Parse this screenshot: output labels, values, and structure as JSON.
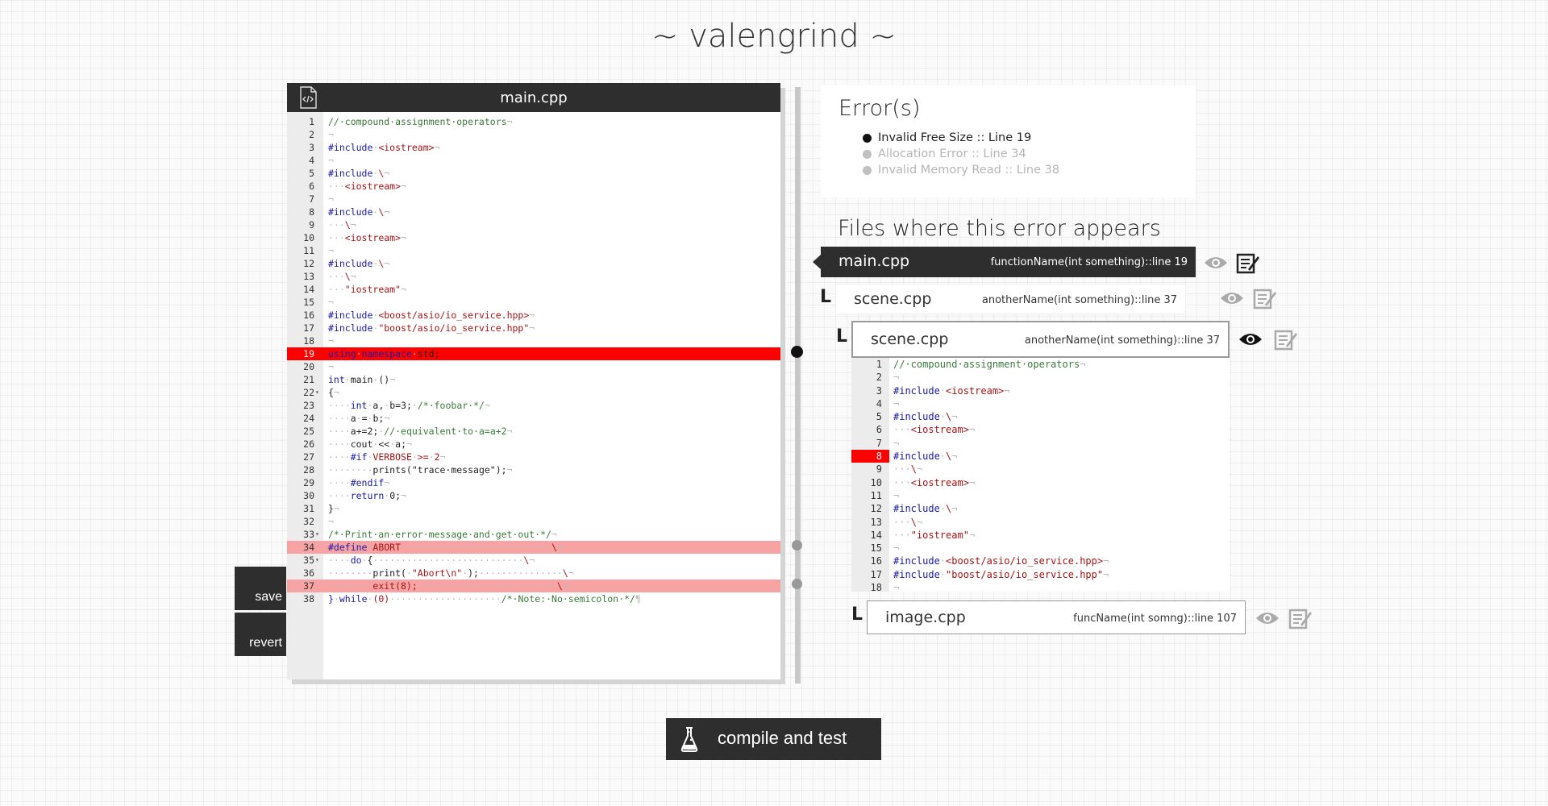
{
  "app": {
    "title": "~ valengrind ~"
  },
  "editor": {
    "filename": "main.cpp",
    "lines": [
      {
        "n": "1",
        "fold": "",
        "state": "",
        "tokens": [
          [
            "cm",
            "//·compound·assignment·operators"
          ],
          [
            "ws",
            "¬"
          ]
        ]
      },
      {
        "n": "2",
        "fold": "",
        "state": "",
        "tokens": [
          [
            "ws",
            "¬"
          ]
        ]
      },
      {
        "n": "3",
        "fold": "",
        "state": "",
        "tokens": [
          [
            "kw",
            "#include"
          ],
          [
            "ws",
            "·"
          ],
          [
            "st",
            "<iostream>"
          ],
          [
            "ws",
            "¬"
          ]
        ]
      },
      {
        "n": "4",
        "fold": "",
        "state": "",
        "tokens": [
          [
            "ws",
            "¬"
          ]
        ]
      },
      {
        "n": "5",
        "fold": "",
        "state": "",
        "tokens": [
          [
            "kw",
            "#include"
          ],
          [
            "ws",
            "·"
          ],
          [
            "st",
            "\\"
          ],
          [
            "ws",
            "¬"
          ]
        ]
      },
      {
        "n": "6",
        "fold": "",
        "state": "",
        "tokens": [
          [
            "ws",
            "···"
          ],
          [
            "st",
            "<iostream>"
          ],
          [
            "ws",
            "¬"
          ]
        ]
      },
      {
        "n": "7",
        "fold": "",
        "state": "",
        "tokens": [
          [
            "ws",
            "¬"
          ]
        ]
      },
      {
        "n": "8",
        "fold": "",
        "state": "",
        "tokens": [
          [
            "kw",
            "#include"
          ],
          [
            "ws",
            "·"
          ],
          [
            "st",
            "\\"
          ],
          [
            "ws",
            "¬"
          ]
        ]
      },
      {
        "n": "9",
        "fold": "",
        "state": "",
        "tokens": [
          [
            "ws",
            "···"
          ],
          [
            "st",
            "\\"
          ],
          [
            "ws",
            "¬"
          ]
        ]
      },
      {
        "n": "10",
        "fold": "",
        "state": "",
        "tokens": [
          [
            "ws",
            "···"
          ],
          [
            "st",
            "<iostream>"
          ],
          [
            "ws",
            "¬"
          ]
        ]
      },
      {
        "n": "11",
        "fold": "",
        "state": "",
        "tokens": [
          [
            "ws",
            "¬"
          ]
        ]
      },
      {
        "n": "12",
        "fold": "",
        "state": "",
        "tokens": [
          [
            "kw",
            "#include"
          ],
          [
            "ws",
            "·"
          ],
          [
            "st",
            "\\"
          ],
          [
            "ws",
            "¬"
          ]
        ]
      },
      {
        "n": "13",
        "fold": "",
        "state": "",
        "tokens": [
          [
            "ws",
            "···"
          ],
          [
            "st",
            "\\"
          ],
          [
            "ws",
            "¬"
          ]
        ]
      },
      {
        "n": "14",
        "fold": "",
        "state": "",
        "tokens": [
          [
            "ws",
            "···"
          ],
          [
            "st",
            "\"iostream\""
          ],
          [
            "ws",
            "¬"
          ]
        ]
      },
      {
        "n": "15",
        "fold": "",
        "state": "",
        "tokens": [
          [
            "ws",
            "¬"
          ]
        ]
      },
      {
        "n": "16",
        "fold": "",
        "state": "",
        "tokens": [
          [
            "kw",
            "#include"
          ],
          [
            "ws",
            "·"
          ],
          [
            "st",
            "<boost/asio/io_service.hpp>"
          ],
          [
            "ws",
            "¬"
          ]
        ]
      },
      {
        "n": "17",
        "fold": "",
        "state": "",
        "tokens": [
          [
            "kw",
            "#include"
          ],
          [
            "ws",
            "·"
          ],
          [
            "st",
            "\"boost/asio/io_service.hpp\""
          ],
          [
            "ws",
            "¬"
          ]
        ]
      },
      {
        "n": "18",
        "fold": "",
        "state": "",
        "tokens": [
          [
            "ws",
            "¬"
          ]
        ]
      },
      {
        "n": "19",
        "fold": "",
        "state": "err",
        "tokens": [
          [
            "kw",
            "using"
          ],
          [
            "ws",
            "·"
          ],
          [
            "kw",
            "namespace"
          ],
          [
            "ws",
            "·"
          ],
          [
            "pl",
            "std;"
          ]
        ]
      },
      {
        "n": "20",
        "fold": "",
        "state": "",
        "tokens": [
          [
            "ws",
            "¬"
          ]
        ]
      },
      {
        "n": "21",
        "fold": "",
        "state": "",
        "tokens": [
          [
            "kw",
            "int"
          ],
          [
            "ws",
            "·"
          ],
          [
            "pl",
            "main"
          ],
          [
            "ws",
            "·"
          ],
          [
            "pl",
            "()"
          ],
          [
            "ws",
            "¬"
          ]
        ]
      },
      {
        "n": "22",
        "fold": "▾",
        "state": "",
        "tokens": [
          [
            "pl",
            "{"
          ],
          [
            "ws",
            "¬"
          ]
        ]
      },
      {
        "n": "23",
        "fold": "",
        "state": "",
        "tokens": [
          [
            "ws",
            "····"
          ],
          [
            "kw",
            "int"
          ],
          [
            "ws",
            "·"
          ],
          [
            "pl",
            "a,"
          ],
          [
            "ws",
            "·"
          ],
          [
            "pl",
            "b=3;"
          ],
          [
            "ws",
            "·"
          ],
          [
            "cm",
            "/*·foobar·*/"
          ],
          [
            "ws",
            "¬"
          ]
        ]
      },
      {
        "n": "24",
        "fold": "",
        "state": "",
        "tokens": [
          [
            "ws",
            "····"
          ],
          [
            "pl",
            "a"
          ],
          [
            "ws",
            "·"
          ],
          [
            "pl",
            "="
          ],
          [
            "ws",
            "·"
          ],
          [
            "pl",
            "b;"
          ],
          [
            "ws",
            "¬"
          ]
        ]
      },
      {
        "n": "25",
        "fold": "",
        "state": "",
        "tokens": [
          [
            "ws",
            "····"
          ],
          [
            "pl",
            "a+=2;"
          ],
          [
            "ws",
            "·"
          ],
          [
            "cm",
            "//·equivalent·to·a=a+2"
          ],
          [
            "ws",
            "¬"
          ]
        ]
      },
      {
        "n": "26",
        "fold": "",
        "state": "",
        "tokens": [
          [
            "ws",
            "····"
          ],
          [
            "pl",
            "cout"
          ],
          [
            "ws",
            "·"
          ],
          [
            "pl",
            "<<"
          ],
          [
            "ws",
            "·"
          ],
          [
            "pl",
            "a;"
          ],
          [
            "ws",
            "¬"
          ]
        ]
      },
      {
        "n": "27",
        "fold": "",
        "state": "",
        "tokens": [
          [
            "ws",
            "····"
          ],
          [
            "kw",
            "#if"
          ],
          [
            "ws",
            "·"
          ],
          [
            "st",
            "VERBOSE"
          ],
          [
            "ws",
            "·"
          ],
          [
            "st",
            ">="
          ],
          [
            "ws",
            "·"
          ],
          [
            "st",
            "2"
          ],
          [
            "ws",
            "¬"
          ]
        ]
      },
      {
        "n": "28",
        "fold": "",
        "state": "",
        "tokens": [
          [
            "ws",
            "········"
          ],
          [
            "pl",
            "prints(\"trace·message\");"
          ],
          [
            "ws",
            "¬"
          ]
        ]
      },
      {
        "n": "29",
        "fold": "",
        "state": "",
        "tokens": [
          [
            "ws",
            "····"
          ],
          [
            "kw",
            "#endif"
          ],
          [
            "ws",
            "¬"
          ]
        ]
      },
      {
        "n": "30",
        "fold": "",
        "state": "",
        "tokens": [
          [
            "ws",
            "····"
          ],
          [
            "kw",
            "return"
          ],
          [
            "ws",
            "·"
          ],
          [
            "pl",
            "0;"
          ],
          [
            "ws",
            "¬"
          ]
        ]
      },
      {
        "n": "31",
        "fold": "",
        "state": "",
        "tokens": [
          [
            "pl",
            "}"
          ],
          [
            "ws",
            "¬"
          ]
        ]
      },
      {
        "n": "32",
        "fold": "",
        "state": "",
        "tokens": [
          [
            "ws",
            "¬"
          ]
        ]
      },
      {
        "n": "33",
        "fold": "▾",
        "state": "",
        "tokens": [
          [
            "cm",
            "/*·Print·an·error·message·and·get·out·*/"
          ],
          [
            "ws",
            "¬"
          ]
        ]
      },
      {
        "n": "34",
        "fold": "",
        "state": "warn",
        "tokens": [
          [
            "kw",
            "#define"
          ],
          [
            "ws",
            "·"
          ],
          [
            "st",
            "ABORT"
          ],
          [
            "ws",
            "···························"
          ],
          [
            "st",
            "\\"
          ],
          [
            "ws",
            "¬"
          ]
        ]
      },
      {
        "n": "35",
        "fold": "▾",
        "state": "",
        "tokens": [
          [
            "ws",
            "····"
          ],
          [
            "kw",
            "do"
          ],
          [
            "ws",
            "·"
          ],
          [
            "pl",
            "{"
          ],
          [
            "ws",
            "···························"
          ],
          [
            "st",
            "\\"
          ],
          [
            "ws",
            "¬"
          ]
        ]
      },
      {
        "n": "36",
        "fold": "",
        "state": "",
        "tokens": [
          [
            "ws",
            "········"
          ],
          [
            "pl",
            "print("
          ],
          [
            "ws",
            "·"
          ],
          [
            "st",
            "\"Abort\\n\""
          ],
          [
            "ws",
            "·"
          ],
          [
            "pl",
            ");"
          ],
          [
            "ws",
            "···············"
          ],
          [
            "st",
            "\\"
          ],
          [
            "ws",
            "¬"
          ]
        ]
      },
      {
        "n": "37",
        "fold": "",
        "state": "warn",
        "tokens": [
          [
            "ws",
            "········"
          ],
          [
            "st",
            "exit(8);"
          ],
          [
            "ws",
            "·························"
          ],
          [
            "st",
            "\\"
          ],
          [
            "ws",
            "¬"
          ]
        ]
      },
      {
        "n": "38",
        "fold": "",
        "state": "",
        "tokens": [
          [
            "kw",
            "}"
          ],
          [
            "ws",
            "·"
          ],
          [
            "kw",
            "while"
          ],
          [
            "ws",
            "·"
          ],
          [
            "st",
            "(0)"
          ],
          [
            "ws",
            "····················"
          ],
          [
            "cm",
            "/*·Note:·No·semicolon·*/"
          ],
          [
            "ws",
            "¶"
          ]
        ]
      }
    ]
  },
  "buttons": {
    "save": "save",
    "revert": "revert",
    "compile": "compile and test"
  },
  "errors": {
    "title": "Error(s)",
    "items": [
      {
        "label": "Invalid Free Size :: Line 19",
        "active": true
      },
      {
        "label": "Allocation Error :: Line 34",
        "active": false
      },
      {
        "label": "Invalid Memory Read :: Line 38",
        "active": false
      }
    ]
  },
  "files": {
    "title": "Files where this error appears",
    "rows": [
      {
        "file": "main.cpp",
        "func": "functionName(int something)::line 19",
        "tree": ""
      },
      {
        "file": "scene.cpp",
        "func": "anotherName(int something)::line 37",
        "tree": "L"
      },
      {
        "file": "scene.cpp",
        "func": "anotherName(int something)::line 37",
        "tree": "L"
      },
      {
        "file": "image.cpp",
        "func": "funcName(int somng)::line 107",
        "tree": "L"
      }
    ]
  },
  "preview": {
    "lines": [
      {
        "n": "1",
        "state": "",
        "tokens": [
          [
            "cm",
            "//·compound·assignment·operators"
          ],
          [
            "ws",
            "¬"
          ]
        ]
      },
      {
        "n": "2",
        "state": "",
        "tokens": [
          [
            "ws",
            "¬"
          ]
        ]
      },
      {
        "n": "3",
        "state": "",
        "tokens": [
          [
            "kw",
            "#include"
          ],
          [
            "ws",
            "·"
          ],
          [
            "st",
            "<iostream>"
          ],
          [
            "ws",
            "¬"
          ]
        ]
      },
      {
        "n": "4",
        "state": "",
        "tokens": [
          [
            "ws",
            "¬"
          ]
        ]
      },
      {
        "n": "5",
        "state": "",
        "tokens": [
          [
            "kw",
            "#include"
          ],
          [
            "ws",
            "·"
          ],
          [
            "st",
            "\\"
          ],
          [
            "ws",
            "¬"
          ]
        ]
      },
      {
        "n": "6",
        "state": "",
        "tokens": [
          [
            "ws",
            "···"
          ],
          [
            "st",
            "<iostream>"
          ],
          [
            "ws",
            "¬"
          ]
        ]
      },
      {
        "n": "7",
        "state": "",
        "tokens": [
          [
            "ws",
            "¬"
          ]
        ]
      },
      {
        "n": "8",
        "state": "err",
        "tokens": [
          [
            "kw",
            "#include"
          ],
          [
            "ws",
            "·"
          ],
          [
            "st",
            "\\"
          ],
          [
            "ws",
            "¬"
          ]
        ]
      },
      {
        "n": "9",
        "state": "",
        "tokens": [
          [
            "ws",
            "···"
          ],
          [
            "st",
            "\\"
          ],
          [
            "ws",
            "¬"
          ]
        ]
      },
      {
        "n": "10",
        "state": "",
        "tokens": [
          [
            "ws",
            "···"
          ],
          [
            "st",
            "<iostream>"
          ],
          [
            "ws",
            "¬"
          ]
        ]
      },
      {
        "n": "11",
        "state": "",
        "tokens": [
          [
            "ws",
            "¬"
          ]
        ]
      },
      {
        "n": "12",
        "state": "",
        "tokens": [
          [
            "kw",
            "#include"
          ],
          [
            "ws",
            "·"
          ],
          [
            "st",
            "\\"
          ],
          [
            "ws",
            "¬"
          ]
        ]
      },
      {
        "n": "13",
        "state": "",
        "tokens": [
          [
            "ws",
            "···"
          ],
          [
            "st",
            "\\"
          ],
          [
            "ws",
            "¬"
          ]
        ]
      },
      {
        "n": "14",
        "state": "",
        "tokens": [
          [
            "ws",
            "···"
          ],
          [
            "st",
            "\"iostream\""
          ],
          [
            "ws",
            "¬"
          ]
        ]
      },
      {
        "n": "15",
        "state": "",
        "tokens": [
          [
            "ws",
            "¬"
          ]
        ]
      },
      {
        "n": "16",
        "state": "",
        "tokens": [
          [
            "kw",
            "#include"
          ],
          [
            "ws",
            "·"
          ],
          [
            "st",
            "<boost/asio/io_service.hpp>"
          ],
          [
            "ws",
            "¬"
          ]
        ]
      },
      {
        "n": "17",
        "state": "",
        "tokens": [
          [
            "kw",
            "#include"
          ],
          [
            "ws",
            "·"
          ],
          [
            "st",
            "\"boost/asio/io_service.hpp\""
          ],
          [
            "ws",
            "¬"
          ]
        ]
      },
      {
        "n": "18",
        "state": "",
        "tokens": [
          [
            "ws",
            "¬"
          ]
        ]
      }
    ]
  },
  "colors": {
    "dark": "#2e2e2e",
    "error_line": "#ff0000",
    "warn_line": "#f8a3a3"
  }
}
